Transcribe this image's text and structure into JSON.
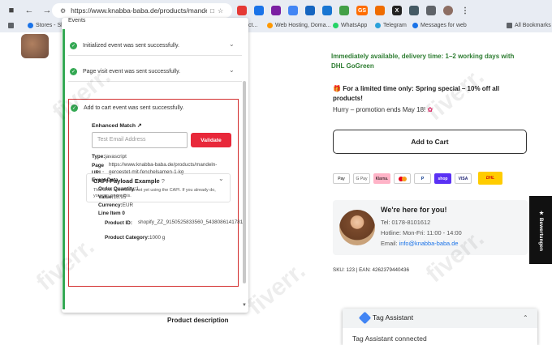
{
  "browser": {
    "url": "https://www.knabba-baba.de/products/mande...",
    "extensions": [
      {
        "icon": "red-badge-icon",
        "color": "#e53935",
        "label": ""
      },
      {
        "icon": "camera-icon",
        "color": "#1a73e8",
        "label": ""
      },
      {
        "icon": "chat-icon",
        "color": "#7b1fa2",
        "label": ""
      },
      {
        "icon": "grid-icon",
        "color": "#4285f4",
        "label": ""
      },
      {
        "icon": "check-icon",
        "color": "#1565c0",
        "label": ""
      },
      {
        "icon": "check-icon",
        "color": "#1976d2",
        "label": ""
      },
      {
        "icon": "doc-icon",
        "color": "#43a047",
        "label": ""
      },
      {
        "icon": "gs-icon",
        "color": "#ff6d00",
        "label": "GS"
      },
      {
        "icon": "play-icon",
        "color": "#ef6c00",
        "label": ""
      },
      {
        "icon": "x-icon",
        "color": "#222222",
        "label": "X"
      },
      {
        "icon": "circle-icon",
        "color": "#455a64",
        "label": ""
      },
      {
        "icon": "puzzle-icon",
        "color": "#5f6368",
        "label": ""
      }
    ]
  },
  "bookmarks": [
    {
      "label": "Stores - Sh",
      "color": "#1a73e8"
    },
    {
      "label": "ct...",
      "color": "#9e9e9e"
    },
    {
      "label": "Web Hosting, Doma...",
      "color": "#ff9800"
    },
    {
      "label": "WhatsApp",
      "color": "#25d366"
    },
    {
      "label": "Telegram",
      "color": "#2aa1da"
    },
    {
      "label": "Messages for web",
      "color": "#1a73e8"
    },
    {
      "label": "All Bookmarks",
      "color": "#5f6368"
    }
  ],
  "events_panel": {
    "title": "Events",
    "events": [
      "Initialized event was sent successfully.",
      "Page visit event was sent successfully.",
      "Add to cart event was sent successfully."
    ],
    "enhanced_match": {
      "title": "Enhanced Match",
      "placeholder": "Test Email Address",
      "validate": "Validate"
    },
    "details": {
      "type_key": "Type:",
      "type_val": "javascript",
      "page_key": "Page URL:",
      "page_val1": "https://www.knabba-baba.de/products/mandeln-",
      "page_val2": "geroestet-mit-fenchelsamen-1-kg",
      "event_data": "Event Data",
      "qty_key": "Order Quantity:",
      "qty_val": "1",
      "value_key": "Value:",
      "value_val": "18.95",
      "cur_key": "Currency:",
      "cur_val": "EUR",
      "line_item": "Line Item 0",
      "pid_key": "Product ID:",
      "pid_val": "shopify_ZZ_9150525833560_54380861417816",
      "cat_key": "Product Category:",
      "cat_val": "1000 g"
    },
    "capi": {
      "title": "CAPI Payload Example",
      "desc": "This is for advertisers not yet using the CAPI. If you already do, you can ignore this."
    }
  },
  "product": {
    "availability": "Immediately available, delivery time: 1–2 working days with DHL GoGreen",
    "special": "For a limited time only: Spring special – 10% off all products!",
    "hurry": "Hurry – promotion ends May 18!",
    "add_to_cart": "Add to Cart",
    "payments": [
      "Pay",
      "G Pay",
      "Klarna.",
      "",
      "P",
      "shop",
      "VISA",
      "DHL"
    ],
    "contact": {
      "heading": "We're here for you!",
      "tel": "Tel: 0178-8101612",
      "hotline": "Hotline: Mon-Fri: 11:00 - 14:00",
      "email_label": "Email: ",
      "email": "info@knabba-baba.de"
    },
    "sku": "SKU: 123 | EAN: 4262379440436",
    "description": "Product description"
  },
  "bewertungen": "★ Bewertungen",
  "tag_assistant": {
    "title": "Tag Assistant",
    "status": "Tag Assistant connected"
  },
  "watermark": "fiverr."
}
